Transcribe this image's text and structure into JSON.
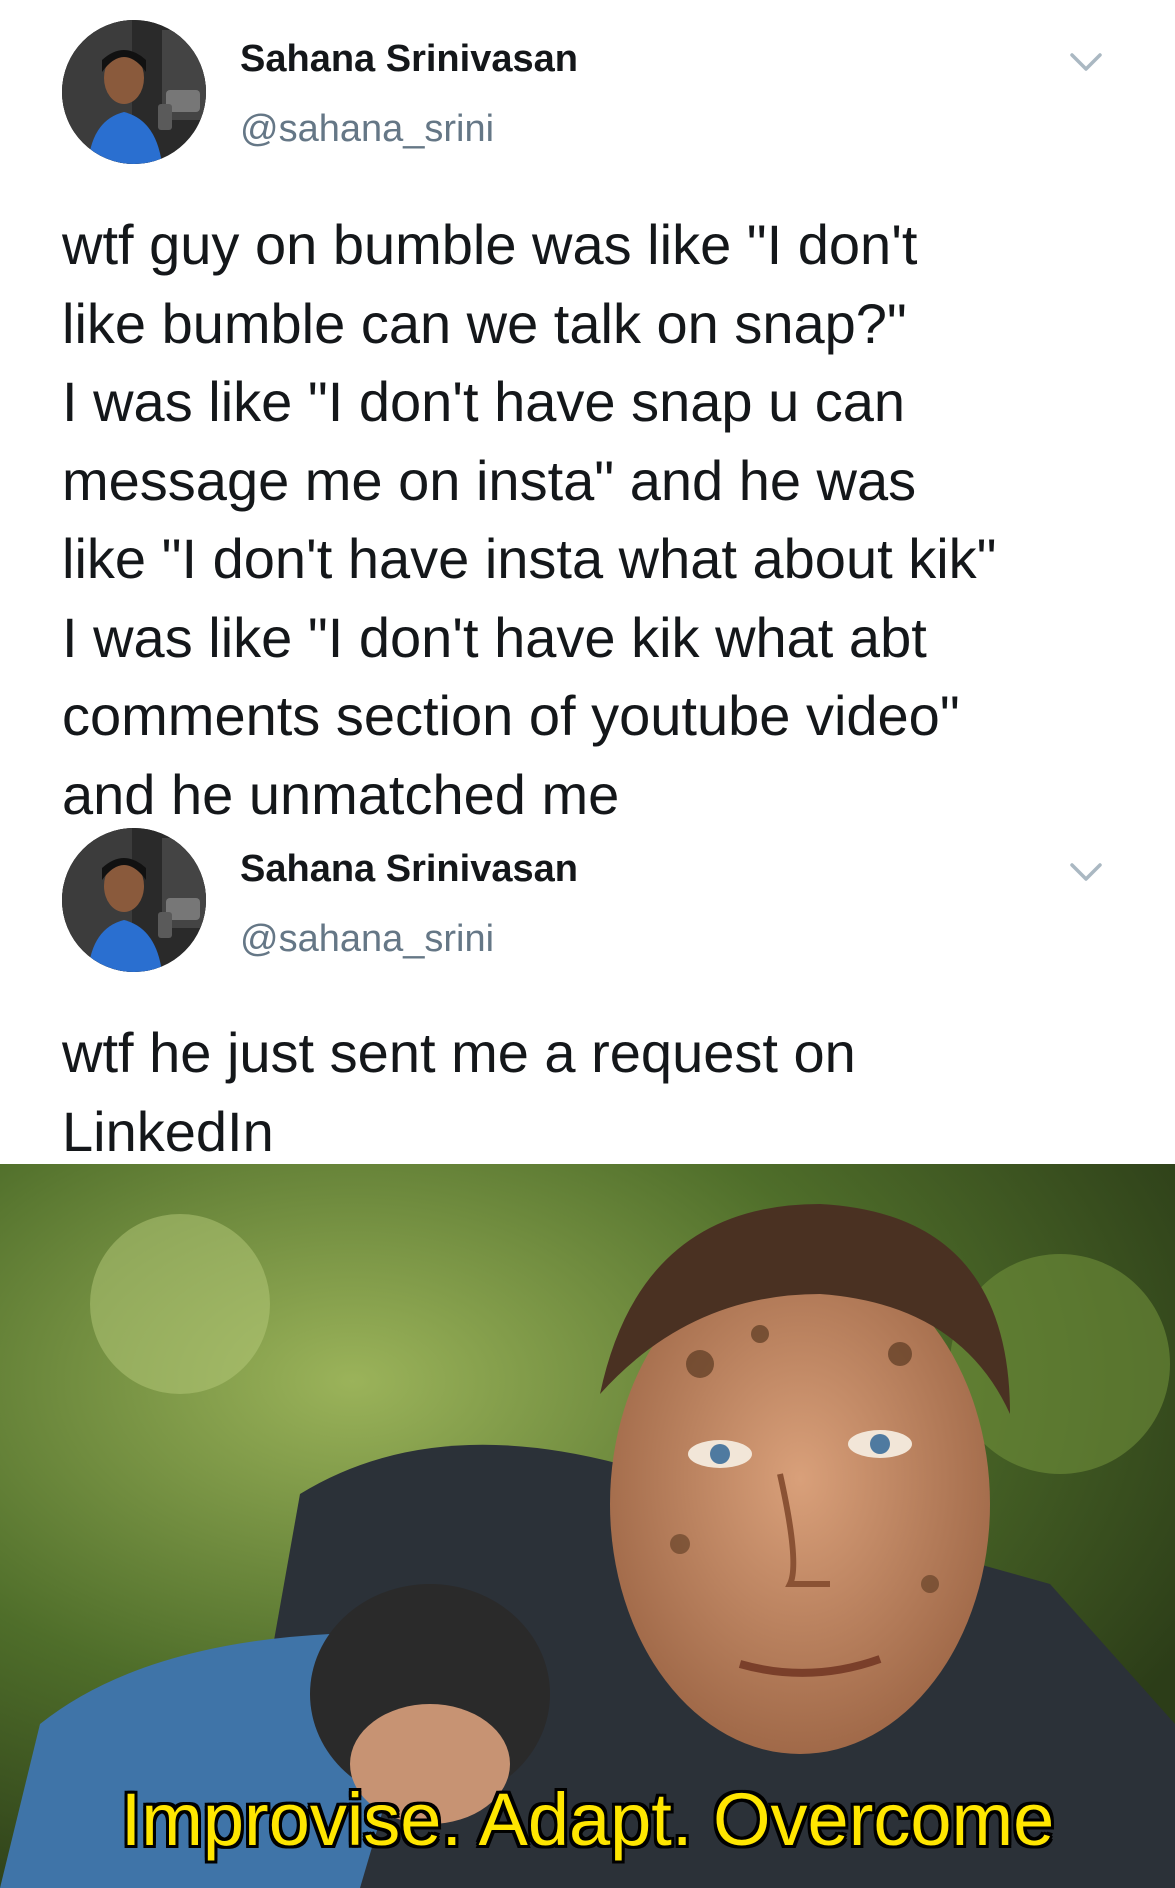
{
  "tweets": [
    {
      "display_name": "Sahana Srinivasan",
      "handle": "@sahana_srini",
      "text": "wtf guy on bumble was like \"I don't\nlike bumble can we talk on snap?\"\nI was like \"I don't have snap u can\nmessage me on insta\" and he was\nlike \"I don't have insta what about kik\"\nI was like \"I don't have kik what abt\ncomments section of youtube video\"\nand he unmatched me",
      "avatar_icon": "profile-photo-avatar",
      "menu_icon": "chevron-down-icon"
    },
    {
      "display_name": "Sahana Srinivasan",
      "handle": "@sahana_srini",
      "text": "wtf he just sent me a request on\nLinkedIn",
      "avatar_icon": "profile-photo-avatar",
      "menu_icon": "chevron-down-icon"
    }
  ],
  "meme": {
    "caption": "Improvise. Adapt. Overcome",
    "caption_color": "#ffe600"
  },
  "colors": {
    "text_primary": "#14171a",
    "text_secondary": "#657786",
    "caret": "#aab8c2"
  }
}
